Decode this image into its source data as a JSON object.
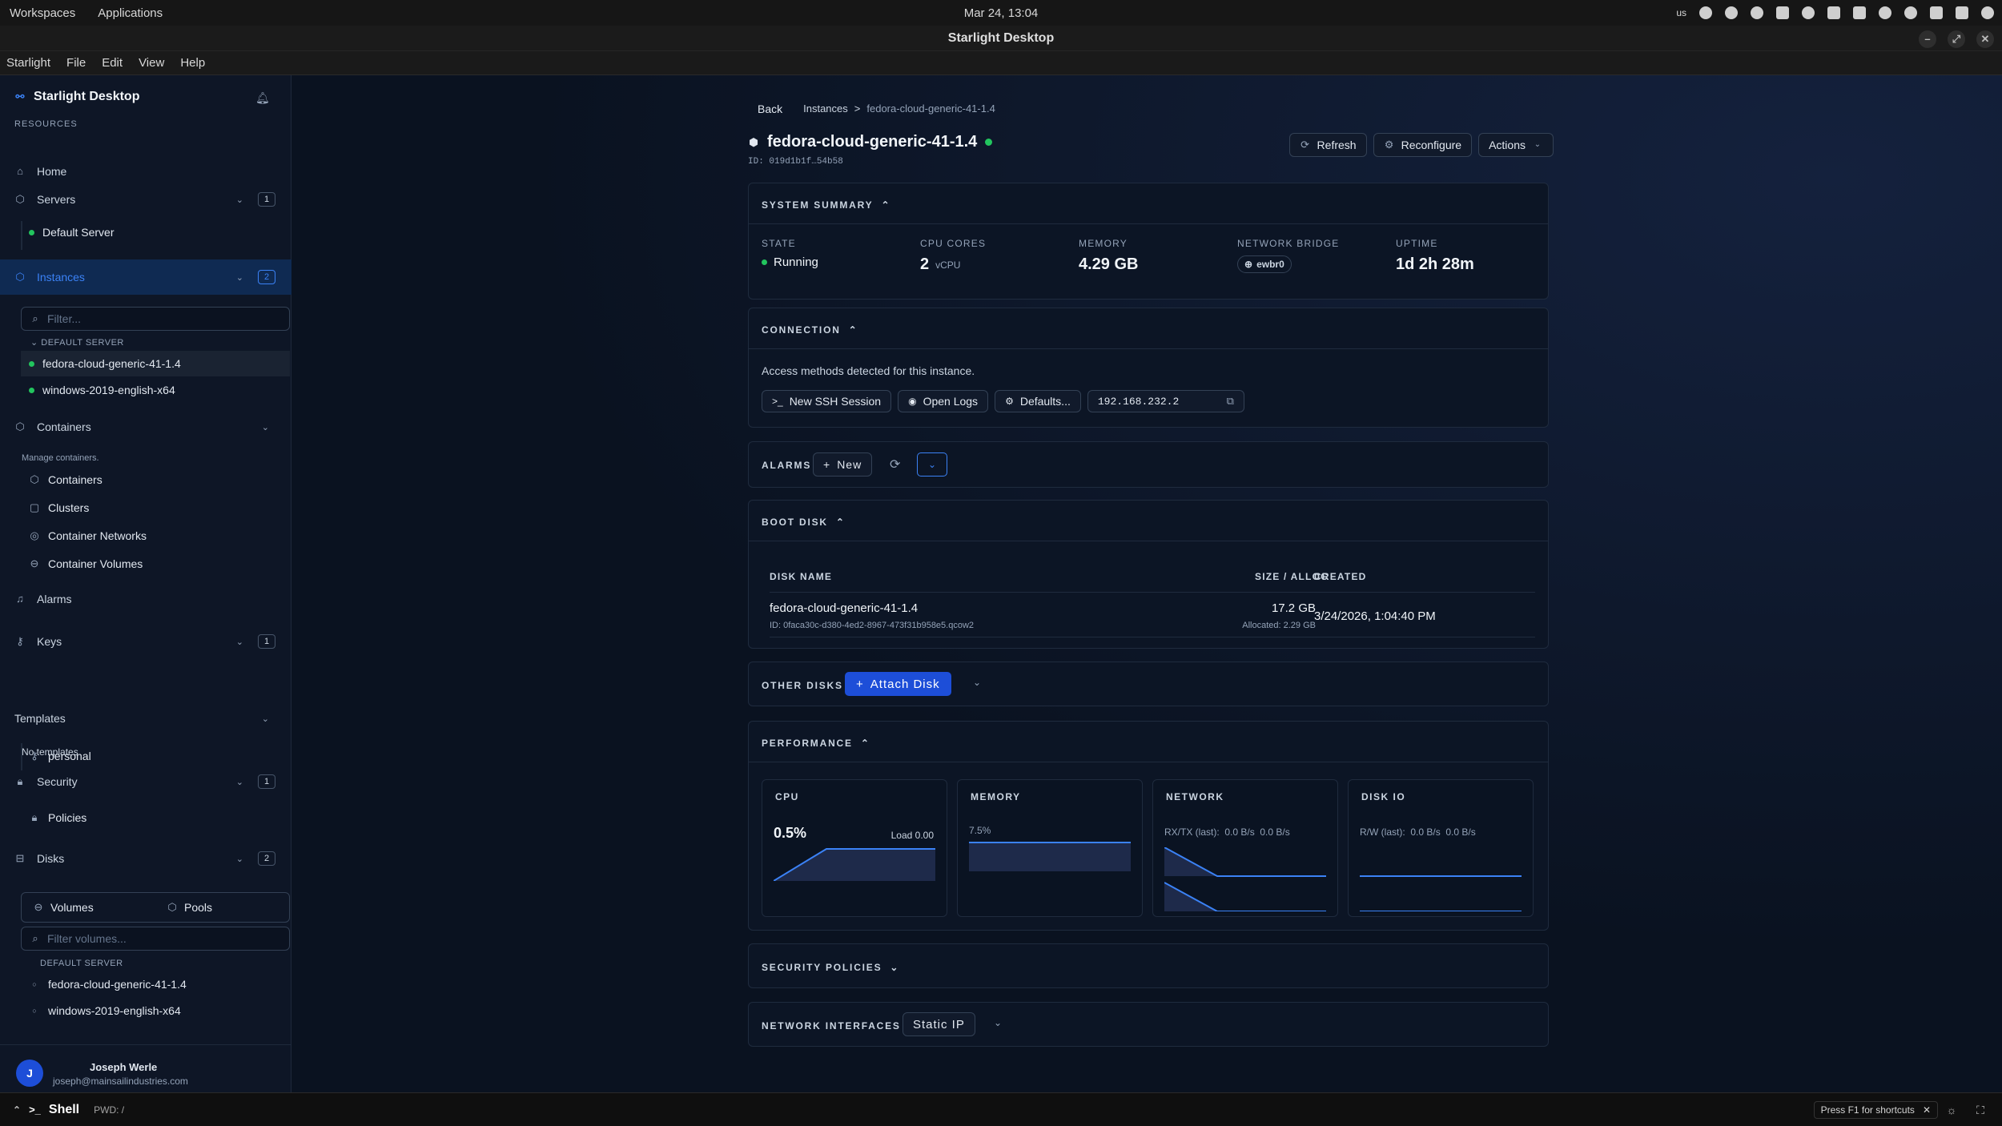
{
  "system": {
    "workspaces": "Workspaces",
    "applications": "Applications",
    "clock": "Mar 24, 13:04",
    "keyboard": "us"
  },
  "window": {
    "title": "Starlight Desktop"
  },
  "menu": [
    "Starlight",
    "File",
    "Edit",
    "View",
    "Help"
  ],
  "sidebar": {
    "app_name": "Starlight Desktop",
    "resources_label": "RESOURCES",
    "home": "Home",
    "servers": {
      "label": "Servers",
      "count": "1",
      "items": [
        "Default Server"
      ]
    },
    "instances": {
      "label": "Instances",
      "count": "2",
      "filter_placeholder": "Filter...",
      "group": "DEFAULT SERVER",
      "items": [
        "fedora-cloud-generic-41-1.4",
        "windows-2019-english-x64"
      ]
    },
    "containers": {
      "label": "Containers",
      "description": "Manage containers.",
      "items": [
        "Containers",
        "Clusters",
        "Container Networks",
        "Container Volumes"
      ]
    },
    "alarms": "Alarms",
    "keys": {
      "label": "Keys",
      "count": "1",
      "items": [
        "personal"
      ]
    },
    "templates": {
      "label": "Templates",
      "empty": "No templates"
    },
    "security": {
      "label": "Security",
      "count": "1",
      "items": [
        "Policies"
      ]
    },
    "disks": {
      "label": "Disks",
      "count": "2",
      "tabs": [
        "Volumes",
        "Pools"
      ],
      "filter_placeholder": "Filter volumes...",
      "group": "DEFAULT SERVER",
      "items": [
        "fedora-cloud-generic-41-1.4",
        "windows-2019-english-x64"
      ]
    },
    "user": {
      "initial": "J",
      "name": "Joseph Werle",
      "email": "joseph@mainsailindustries.com"
    }
  },
  "breadcrumb": {
    "back": "Back",
    "instances": "Instances",
    "sep": ">",
    "current": "fedora-cloud-generic-41-1.4"
  },
  "instance": {
    "name": "fedora-cloud-generic-41-1.4",
    "id": "ID: 019d1b1f…54b58",
    "status_color": "#22c55e",
    "actions": {
      "refresh": "Refresh",
      "reconfigure": "Reconfigure",
      "more": "Actions"
    }
  },
  "summary": {
    "title": "SYSTEM SUMMARY",
    "state_label": "STATE",
    "state": "Running",
    "cpu_label": "CPU CORES",
    "cpu": "2",
    "cpu_unit": "vCPU",
    "memory_label": "MEMORY",
    "memory": "4.29 GB",
    "bridge_label": "NETWORK BRIDGE",
    "bridge": "ewbr0",
    "uptime_label": "UPTIME",
    "uptime": "1d 2h 28m"
  },
  "connection": {
    "title": "CONNECTION",
    "description": "Access methods detected for this instance.",
    "ssh": "New SSH Session",
    "logs": "Open Logs",
    "defaults": "Defaults...",
    "ip": "192.168.232.2"
  },
  "alarms": {
    "title": "ALARMS",
    "new": "New"
  },
  "boot_disk": {
    "title": "BOOT DISK",
    "columns": [
      "DISK NAME",
      "SIZE / ALLOC",
      "CREATED"
    ],
    "row": {
      "name": "fedora-cloud-generic-41-1.4",
      "id": "ID: 0faca30c-d380-4ed2-8967-473f31b958e5.qcow2",
      "size": "17.2 GB",
      "allocated": "Allocated: 2.29 GB",
      "created": "3/24/2026, 1:04:40 PM"
    }
  },
  "other_disks": {
    "title": "OTHER DISKS",
    "attach": "Attach Disk"
  },
  "performance": {
    "title": "PERFORMANCE",
    "cpu": {
      "title": "CPU",
      "value": "0.5%",
      "load": "Load 0.00"
    },
    "memory": {
      "title": "MEMORY",
      "value": "7.5%"
    },
    "network": {
      "title": "NETWORK",
      "label": "RX/TX (last):",
      "rx": "0.0 B/s",
      "tx": "0.0 B/s"
    },
    "disk": {
      "title": "DISK IO",
      "label": "R/W (last):",
      "r": "0.0 B/s",
      "w": "0.0 B/s"
    }
  },
  "security_policies": {
    "title": "SECURITY POLICIES"
  },
  "network_interfaces": {
    "title": "NETWORK INTERFACES",
    "static_ip": "Static IP"
  },
  "shell": {
    "label": "Shell",
    "pwd": "PWD: /",
    "hint": "Press F1 for shortcuts"
  }
}
